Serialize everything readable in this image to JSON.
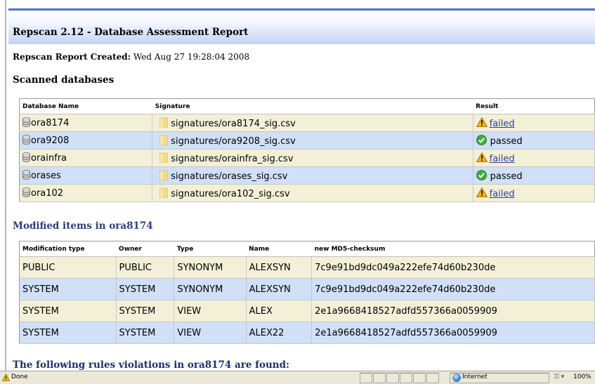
{
  "report": {
    "title": "Repscan 2.12 - Database Assessment Report",
    "created_label": "Repscan Report Created:",
    "created_value": "Wed Aug 27 19:28:04 2008"
  },
  "scanned": {
    "heading": "Scanned databases",
    "columns": [
      "Database Name",
      "Signature",
      "Result"
    ],
    "rows": [
      {
        "name": "ora8174",
        "signature": "signatures/ora8174_sig.csv",
        "result": "failed"
      },
      {
        "name": "ora9208",
        "signature": "signatures/ora9208_sig.csv",
        "result": "passed"
      },
      {
        "name": "orainfra",
        "signature": "signatures/orainfra_sig.csv",
        "result": "failed"
      },
      {
        "name": "orases",
        "signature": "signatures/orases_sig.csv",
        "result": "passed"
      },
      {
        "name": "ora102",
        "signature": "signatures/ora102_sig.csv",
        "result": "failed"
      }
    ]
  },
  "modified": {
    "heading": "Modified items in ora8174",
    "columns": [
      "Modification type",
      "Owner",
      "Type",
      "Name",
      "new MD5-checksum"
    ],
    "rows": [
      {
        "mod_type": "PUBLIC",
        "owner": "PUBLIC",
        "type": "SYNONYM",
        "name": "ALEXSYN",
        "md5": "7c9e91bd9dc049a222efe74d60b230de"
      },
      {
        "mod_type": "SYSTEM",
        "owner": "SYSTEM",
        "type": "SYNONYM",
        "name": "ALEXSYN",
        "md5": "7c9e91bd9dc049a222efe74d60b230de"
      },
      {
        "mod_type": "SYSTEM",
        "owner": "SYSTEM",
        "type": "VIEW",
        "name": "ALEX",
        "md5": "2e1a9668418527adfd557366a0059909"
      },
      {
        "mod_type": "SYSTEM",
        "owner": "SYSTEM",
        "type": "VIEW",
        "name": "ALEX22",
        "md5": "2e1a9668418527adfd557366a0059909"
      }
    ]
  },
  "rules": {
    "heading": "The following rules violations in ora8174 are found:"
  },
  "statusbar": {
    "status_text": "Done",
    "zone": "Internet",
    "zoom": "100%"
  },
  "colors": {
    "row_tan": "#f4f0d8",
    "row_blue": "#cfe0f7",
    "header_accent": "#4a6fd0",
    "link": "#2d3ea0"
  }
}
